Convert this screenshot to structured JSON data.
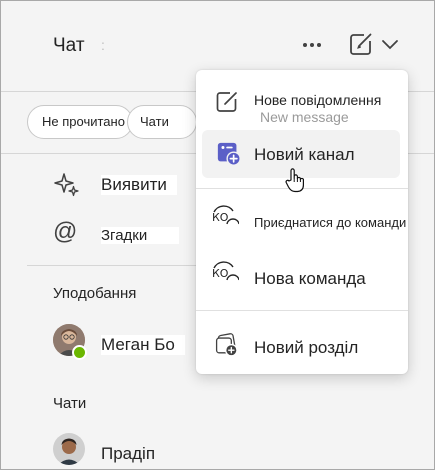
{
  "header": {
    "title": "Чат"
  },
  "filters": [
    {
      "label": "Не прочитано"
    },
    {
      "label": "Чати"
    }
  ],
  "nav": {
    "discover": "Виявити",
    "mentions": "Згадки"
  },
  "favorites": {
    "heading": "Уподобання",
    "items": [
      {
        "name": "Меган Бо",
        "status": "available"
      }
    ]
  },
  "chats": {
    "heading": "Чати",
    "items": [
      {
        "name": "Прадіп"
      }
    ]
  },
  "menu": {
    "ghost_text": "New message",
    "items": [
      {
        "label": "Нове повідомлення",
        "icon": "compose-icon"
      },
      {
        "label": "Новий канал",
        "icon": "new-channel-icon"
      },
      {
        "label": "Приєднатися до команди",
        "icon": "join-team-icon"
      },
      {
        "label": "Нова команда",
        "icon": "new-team-icon"
      },
      {
        "label": "Новий розділ",
        "icon": "new-section-icon"
      }
    ],
    "team_icon_text": "КО"
  },
  "colors": {
    "accent": "#5b5fc7",
    "presence_available": "#6bb700",
    "background": "#f4f4f4"
  }
}
